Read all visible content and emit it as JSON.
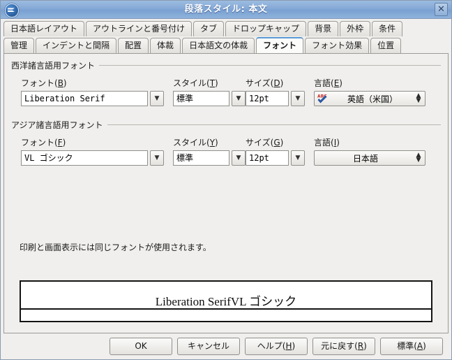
{
  "window": {
    "title": "段落スタイル: 本文",
    "icon": "window-menu-icon",
    "close_label": "✕"
  },
  "tabs": {
    "row1": [
      {
        "label": "日本語レイアウト",
        "active": false
      },
      {
        "label": "アウトラインと番号付け",
        "active": false
      },
      {
        "label": "タブ",
        "active": false
      },
      {
        "label": "ドロップキャップ",
        "active": false
      },
      {
        "label": "背景",
        "active": false
      },
      {
        "label": "外枠",
        "active": false
      },
      {
        "label": "条件",
        "active": false
      }
    ],
    "row2": [
      {
        "label": "管理",
        "active": false
      },
      {
        "label": "インデントと間隔",
        "active": false
      },
      {
        "label": "配置",
        "active": false
      },
      {
        "label": "体裁",
        "active": false
      },
      {
        "label": "日本語文の体裁",
        "active": false
      },
      {
        "label": "フォント",
        "active": true
      },
      {
        "label": "フォント効果",
        "active": false
      },
      {
        "label": "位置",
        "active": false
      }
    ]
  },
  "western": {
    "group_title": "西洋諸言語用フォント",
    "font": {
      "label_pre": "フォント(",
      "accel": "B",
      "label_post": ")",
      "value": "Liberation Serif"
    },
    "style": {
      "label_pre": "スタイル(",
      "accel": "T",
      "label_post": ")",
      "value": "標準"
    },
    "size": {
      "label_pre": "サイズ(",
      "accel": "D",
      "label_post": ")",
      "value": "12pt"
    },
    "language": {
      "label_pre": "言語(",
      "accel": "E",
      "label_post": ")",
      "value": "英語（米国）",
      "icon": "spellcheck-abc-icon"
    }
  },
  "asian": {
    "group_title": "アジア諸言語用フォント",
    "font": {
      "label_pre": "フォント(",
      "accel": "F",
      "label_post": ")",
      "value": "VL  ゴシック"
    },
    "style": {
      "label_pre": "スタイル(",
      "accel": "Y",
      "label_post": ")",
      "value": "標準"
    },
    "size": {
      "label_pre": "サイズ(",
      "accel": "G",
      "label_post": ")",
      "value": "12pt"
    },
    "language": {
      "label_pre": "言語(",
      "accel": "I",
      "label_post": ")",
      "value": "日本語",
      "icon": "none"
    }
  },
  "hint": "印刷と画面表示には同じフォントが使用されます。",
  "preview": {
    "text": "Liberation SerifVL ゴシック"
  },
  "buttons": [
    {
      "label_pre": "OK",
      "accel": "",
      "label_post": ""
    },
    {
      "label_pre": "キャンセル",
      "accel": "",
      "label_post": ""
    },
    {
      "label_pre": "ヘルプ(",
      "accel": "H",
      "label_post": ")"
    },
    {
      "label_pre": "元に戻す(",
      "accel": "R",
      "label_post": ")"
    },
    {
      "label_pre": "標準(",
      "accel": "A",
      "label_post": ")"
    }
  ],
  "colors": {
    "titlebar_blue": "#85a9d6",
    "active_tab_accent": "#5b9bd5",
    "panel_bg": "#f0efed"
  }
}
